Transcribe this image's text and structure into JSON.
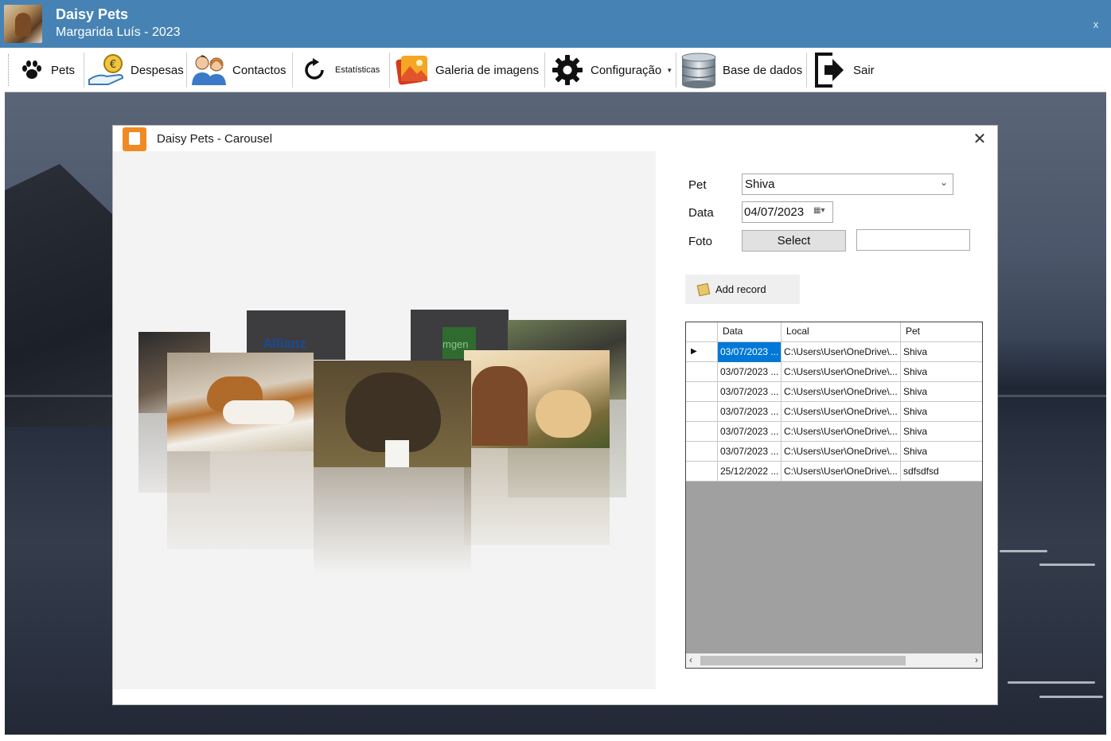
{
  "app": {
    "title": "Daisy Pets",
    "subtitle": "Margarida Luís - 2023",
    "close": "x"
  },
  "toolbar": {
    "items": [
      {
        "label": "Pets",
        "icon": "paw-icon"
      },
      {
        "label": "Despesas",
        "icon": "euro-hand-icon"
      },
      {
        "label": "Contactos",
        "icon": "people-icon"
      },
      {
        "label": "Estatísticas",
        "icon": "refresh-icon"
      },
      {
        "label": "Galeria de imagens",
        "icon": "gallery-icon"
      },
      {
        "label": "Configuração",
        "icon": "gear-icon"
      },
      {
        "label": "Base de dados",
        "icon": "database-icon"
      },
      {
        "label": "Sair",
        "icon": "exit-icon"
      }
    ],
    "caret": "▼"
  },
  "carousel_window": {
    "title": "Daisy Pets - Carousel",
    "close": "✕",
    "logos": [
      "Allianz",
      "mgen"
    ]
  },
  "form": {
    "pet_label": "Pet",
    "pet_value": "Shiva",
    "data_label": "Data",
    "data_value": "04/07/2023",
    "foto_label": "Foto",
    "select_label": "Select",
    "foto_value": "",
    "add_record_label": "Add record"
  },
  "grid": {
    "columns": [
      "Data",
      "Local",
      "Pet"
    ],
    "rows": [
      {
        "data": "03/07/2023 ...",
        "local": "C:\\Users\\User\\OneDrive\\...",
        "pet": "Shiva"
      },
      {
        "data": "03/07/2023 ...",
        "local": "C:\\Users\\User\\OneDrive\\...",
        "pet": "Shiva"
      },
      {
        "data": "03/07/2023 ...",
        "local": "C:\\Users\\User\\OneDrive\\...",
        "pet": "Shiva"
      },
      {
        "data": "03/07/2023 ...",
        "local": "C:\\Users\\User\\OneDrive\\...",
        "pet": "Shiva"
      },
      {
        "data": "03/07/2023 ...",
        "local": "C:\\Users\\User\\OneDrive\\...",
        "pet": "Shiva"
      },
      {
        "data": "03/07/2023 ...",
        "local": "C:\\Users\\User\\OneDrive\\...",
        "pet": "Shiva"
      },
      {
        "data": "25/12/2022 ...",
        "local": "C:\\Users\\User\\OneDrive\\...",
        "pet": "sdfsdfsd"
      }
    ],
    "selected_row": 0
  },
  "colors": {
    "titlebar": "#4683b4",
    "selection": "#0078d7",
    "grid_empty": "#a0a0a0"
  }
}
